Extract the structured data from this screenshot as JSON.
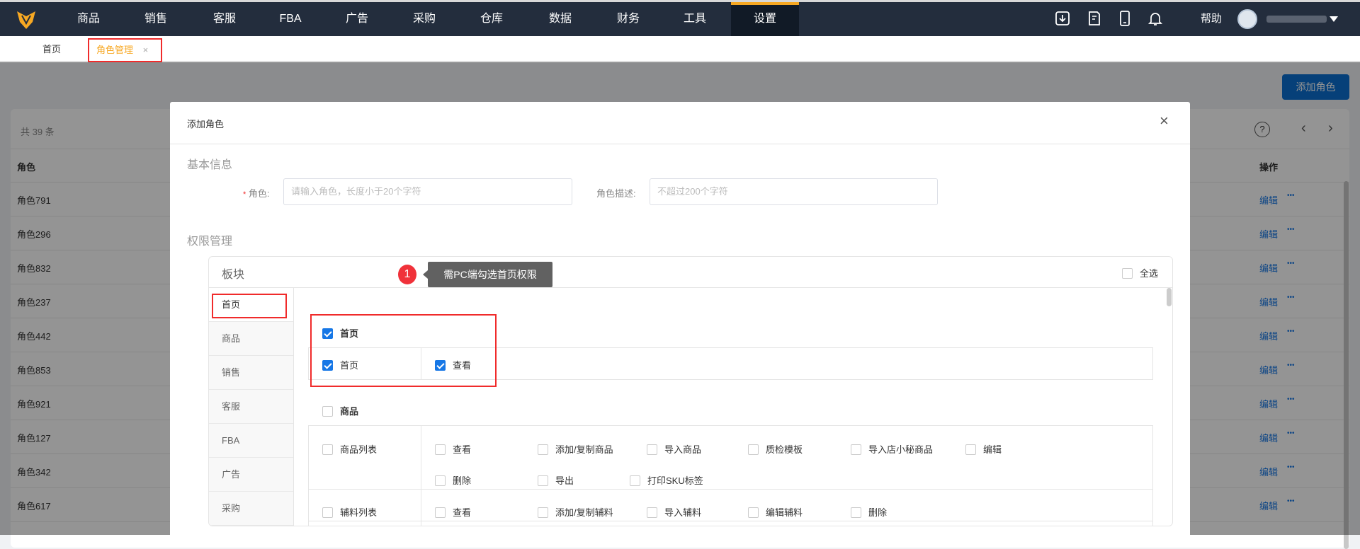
{
  "nav": {
    "items": [
      "商品",
      "销售",
      "客服",
      "FBA",
      "广告",
      "采购",
      "仓库",
      "数据",
      "财务",
      "工具",
      "设置"
    ],
    "active": "设置",
    "help": "帮助"
  },
  "tabs": [
    {
      "label": "首页"
    },
    {
      "label": "角色管理",
      "close": "×"
    }
  ],
  "page": {
    "add_button": "添加角色",
    "total": "共 39 条",
    "col_role": "角色",
    "col_action": "操作",
    "edit": "编辑",
    "more": "•••",
    "rows": [
      "角色791",
      "角色296",
      "角色832",
      "角色237",
      "角色442",
      "角色853",
      "角色921",
      "角色127",
      "角色342",
      "角色617"
    ]
  },
  "modal": {
    "title": "添加角色",
    "close": "×",
    "basic_info": "基本信息",
    "role_label": "角色:",
    "required_mark": "*",
    "role_placeholder": "请输入角色，长度小于20个字符",
    "desc_label": "角色描述:",
    "desc_placeholder": "不超过200个字符",
    "perm_title": "权限管理",
    "perm": {
      "header": "板块",
      "select_all": "全选",
      "modules": [
        "首页",
        "商品",
        "销售",
        "客服",
        "FBA",
        "广告",
        "采购"
      ],
      "home": {
        "group": "首页",
        "row": "首页",
        "actions": [
          "查看"
        ]
      },
      "goods": {
        "group": "商品",
        "rows": [
          {
            "name": "商品列表",
            "actions": [
              "查看",
              "添加/复制商品",
              "导入商品",
              "质检模板",
              "导入店小秘商品",
              "编辑",
              "删除",
              "导出",
              "打印SKU标签"
            ]
          },
          {
            "name": "辅料列表",
            "actions": [
              "查看",
              "添加/复制辅料",
              "导入辅料",
              "编辑辅料",
              "删除"
            ]
          }
        ]
      }
    }
  },
  "annotation": {
    "number": "1",
    "text": "需PC端勾选首页权限"
  },
  "colors": {
    "accent": "#1677e6",
    "nav_bg": "#232d3d",
    "tab_active": "#f7a823",
    "highlight": "#f02b2b"
  }
}
